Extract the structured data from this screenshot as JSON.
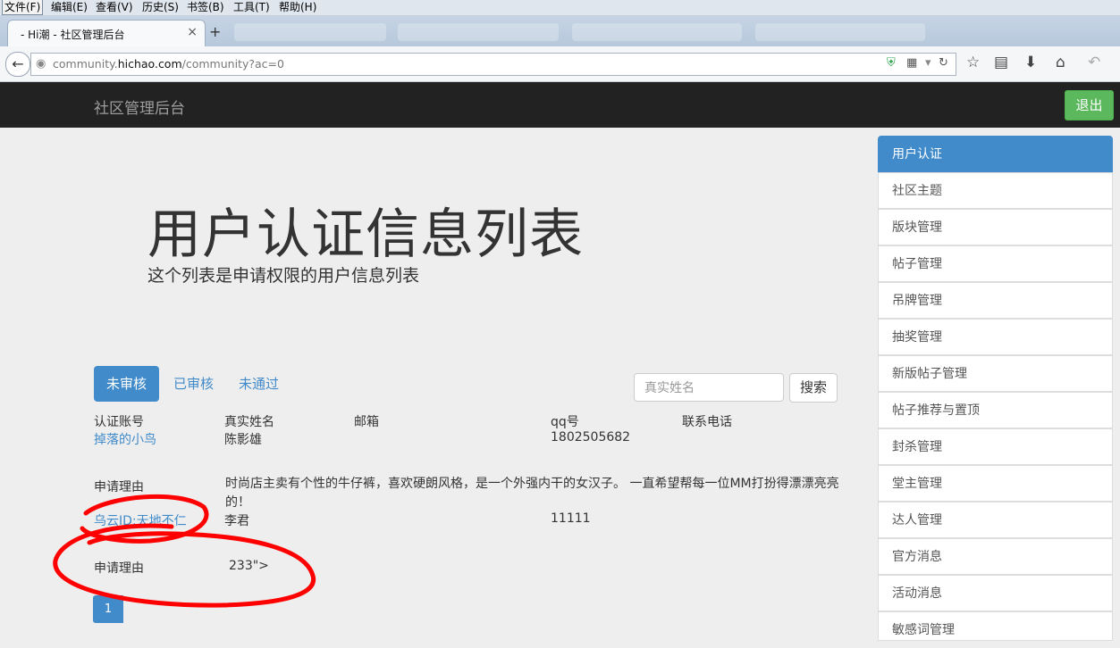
{
  "browser": {
    "menu": [
      "文件(F)",
      "编辑(E)",
      "查看(V)",
      "历史(S)",
      "书签(B)",
      "工具(T)",
      "帮助(H)"
    ],
    "tab_title": "- Hi潮 - 社区管理后台",
    "tab_close": "×",
    "new_tab": "+",
    "url_prefix": "community.",
    "url_domain": "hichao.com",
    "url_suffix": "/community?ac=0"
  },
  "header": {
    "brand": "社区管理后台",
    "logout": "退出"
  },
  "hero": {
    "title": "用户认证信息列表",
    "subtitle": "这个列表是申请权限的用户信息列表"
  },
  "tabs": [
    {
      "label": "未审核",
      "active": true
    },
    {
      "label": "已审核",
      "active": false
    },
    {
      "label": "未通过",
      "active": false
    }
  ],
  "search": {
    "placeholder": "真实姓名",
    "button": "搜索"
  },
  "table": {
    "headers": [
      "认证账号",
      "真实姓名",
      "邮箱",
      "qq号",
      "联系电话"
    ],
    "reason_label": "申请理由",
    "rows": [
      {
        "account": "掉落的小鸟",
        "real_name": "陈影雄",
        "email": "",
        "qq": "1802505682",
        "phone": "",
        "reason": "时尚店主卖有个性的牛仔裤，喜欢硬朗风格，是一个外强内干的女汉子。 一直希望帮每一位MM打扮得漂漂亮亮的！"
      },
      {
        "account": "乌云ID:天地不仁",
        "real_name": "李君",
        "email": "",
        "qq": "11111",
        "phone": "",
        "reason": "233\">"
      }
    ]
  },
  "pagination": {
    "pages": [
      "1"
    ],
    "current": "1"
  },
  "sidebar": {
    "items": [
      {
        "label": "用户认证",
        "active": true
      },
      {
        "label": "社区主题",
        "active": false
      },
      {
        "label": "版块管理",
        "active": false
      },
      {
        "label": "帖子管理",
        "active": false
      },
      {
        "label": "吊牌管理",
        "active": false
      },
      {
        "label": "抽奖管理",
        "active": false
      },
      {
        "label": "新版帖子管理",
        "active": false
      },
      {
        "label": "帖子推荐与置顶",
        "active": false
      },
      {
        "label": "封杀管理",
        "active": false
      },
      {
        "label": "堂主管理",
        "active": false
      },
      {
        "label": "达人管理",
        "active": false
      },
      {
        "label": "官方消息",
        "active": false
      },
      {
        "label": "活动消息",
        "active": false
      },
      {
        "label": "敏感词管理",
        "active": false
      }
    ]
  },
  "colors": {
    "primary": "#428bca",
    "success": "#5cb85c",
    "navbar": "#222222",
    "annotation": "#ff0000"
  }
}
